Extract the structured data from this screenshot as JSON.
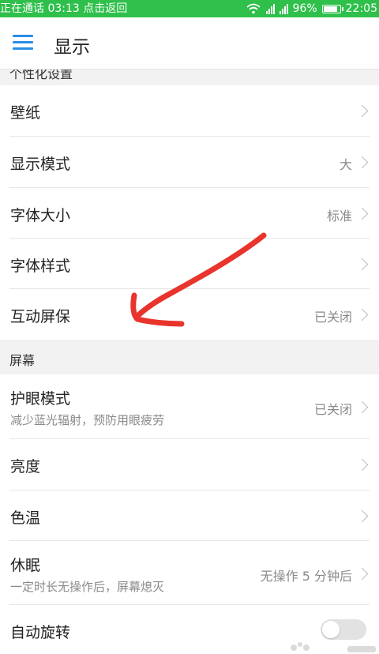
{
  "status_bar": {
    "left_text": "正在通话 03:13 点击返回",
    "battery": "96%",
    "battery_level": 0.96,
    "time": "22:05",
    "color": "#2fbf4b"
  },
  "app_bar": {
    "title": "显示",
    "menu_icon": "hamburger-menu-icon",
    "accent": "#2a8de6"
  },
  "sections": {
    "personalization_header": "个性化设置",
    "screen_header": "屏幕"
  },
  "personalization_items": [
    {
      "label": "壁纸",
      "value": ""
    },
    {
      "label": "显示模式",
      "value": "大"
    },
    {
      "label": "字体大小",
      "value": "标准"
    },
    {
      "label": "字体样式",
      "value": ""
    },
    {
      "label": "互动屏保",
      "value": "已关闭"
    }
  ],
  "screen_items": {
    "eye_care": {
      "label": "护眼模式",
      "sub": "减少蓝光辐射，预防用眼疲劳",
      "value": "已关闭"
    },
    "brightness": {
      "label": "亮度"
    },
    "color_temp": {
      "label": "色温"
    },
    "sleep": {
      "label": "休眠",
      "sub": "一定时长无操作后，屏幕熄灭",
      "value": "无操作 5 分钟后"
    },
    "auto_rotate": {
      "label": "自动旋转",
      "toggle_on": false
    }
  },
  "annotation": {
    "color": "#e8342c",
    "icon": "red-hand-drawn-arrow"
  }
}
